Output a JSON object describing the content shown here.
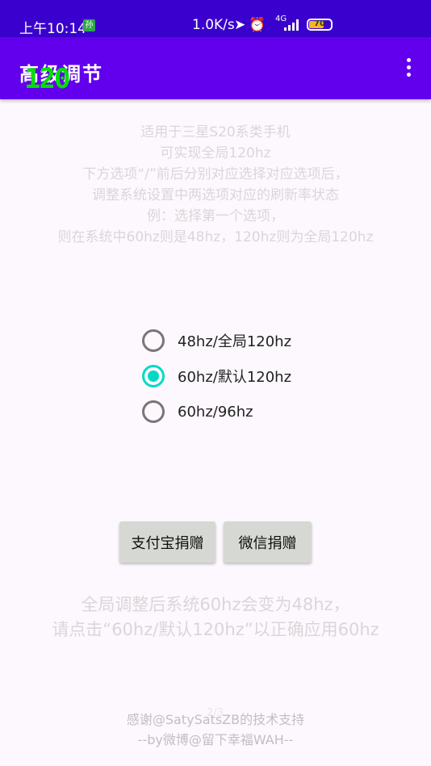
{
  "status_bar": {
    "time": "上午10:14",
    "sim_label": "孙",
    "net_speed": "1.0K/s",
    "network_type": "4G",
    "battery_level": "70",
    "battery_fraction": 0.7
  },
  "app_bar": {
    "title": "高级调节",
    "fps_overlay": "120"
  },
  "description": [
    "适用于三星S20系类手机",
    "可实现全局120hz",
    "下方选项“/”前后分别对应选择对应选项后，",
    "调整系统设置中两选项对应的刷新率状态",
    "例：选择第一个选项，",
    "则在系统中60hz则是48hz，120hz则为全局120hz"
  ],
  "options": [
    {
      "label": "48hz/全局120hz",
      "checked": false
    },
    {
      "label": "60hz/默认120hz",
      "checked": true
    },
    {
      "label": "60hz/96hz",
      "checked": false
    }
  ],
  "buttons": {
    "alipay": "支付宝捐赠",
    "wechat": "微信捐赠"
  },
  "warning": [
    "全局调整后系统60hz会变为48hz，",
    "请点击“60hz/默认120hz”以正确应用60hz"
  ],
  "footer": {
    "pager": "2/3",
    "thanks": "感谢@SatySatsZB的技术支持",
    "author": "--by微博@留下幸福WAH--"
  },
  "colors": {
    "status_bar": "#3a00cd",
    "app_bar": "#6200ee",
    "accent": "#03dac5",
    "button": "#d6d8d3"
  }
}
